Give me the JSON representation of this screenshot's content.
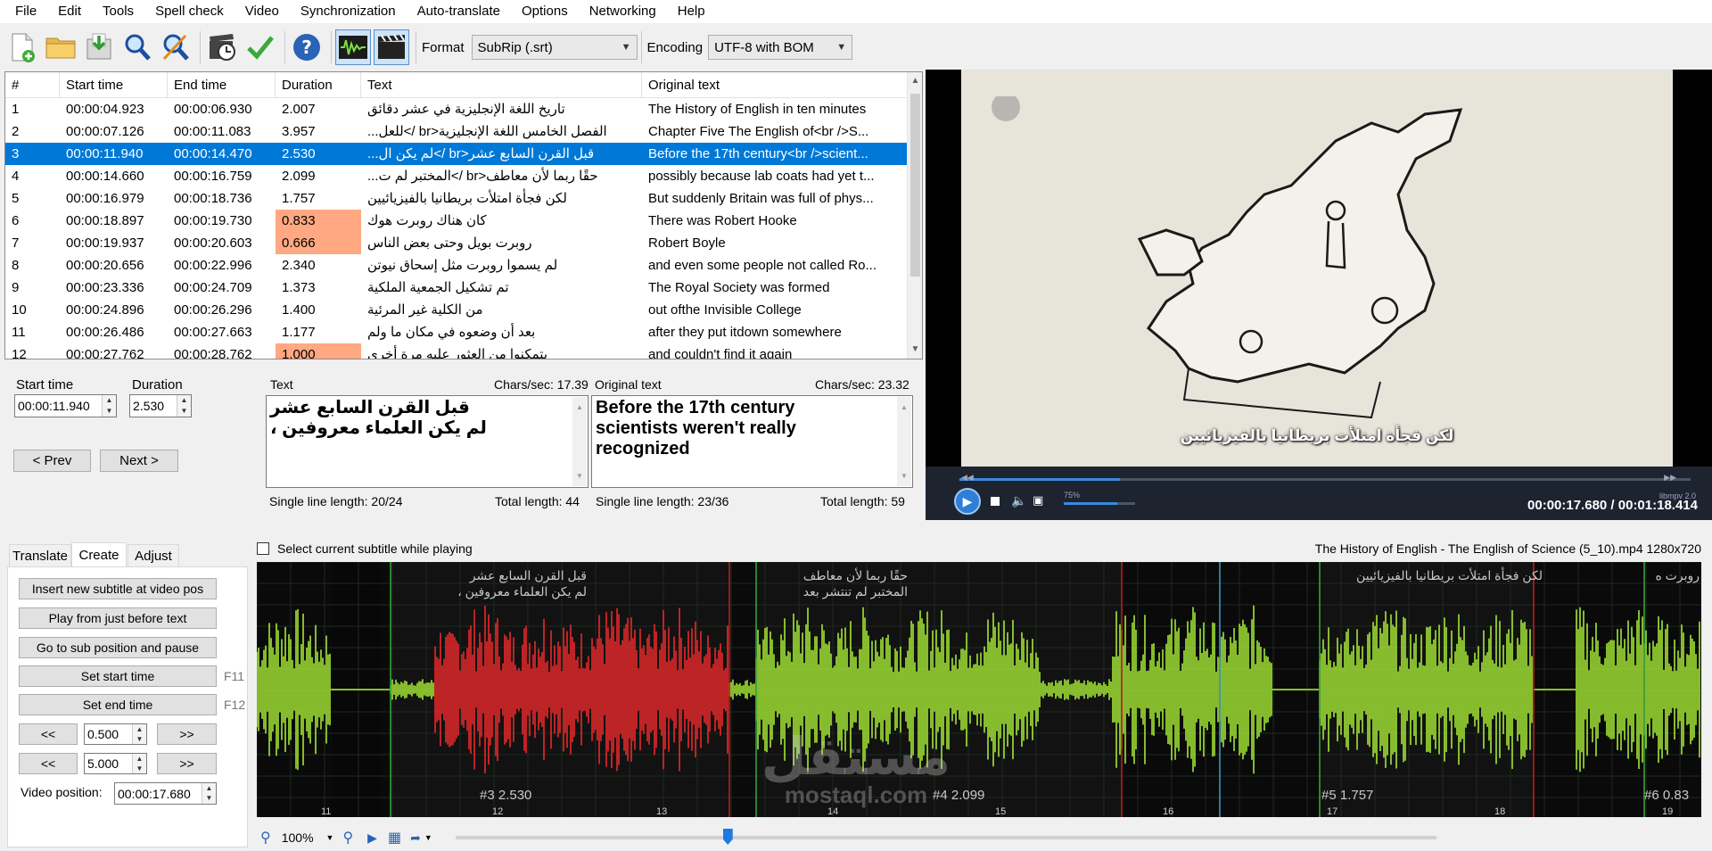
{
  "menu": [
    "File",
    "Edit",
    "Tools",
    "Spell check",
    "Video",
    "Synchronization",
    "Auto-translate",
    "Options",
    "Networking",
    "Help"
  ],
  "toolbar": {
    "icons": [
      "new-file-icon",
      "open-folder-icon",
      "save-icon",
      "find-icon",
      "replace-icon",
      "visual-sync-icon",
      "spell-check-icon",
      "help-icon",
      "waveform-toggle-icon",
      "video-toggle-icon"
    ],
    "format_label": "Format",
    "format_value": "SubRip (.srt)",
    "encoding_label": "Encoding",
    "encoding_value": "UTF-8 with BOM"
  },
  "grid": {
    "headers": [
      "#",
      "Start time",
      "End time",
      "Duration",
      "Text",
      "Original text"
    ],
    "rows": [
      {
        "num": "1",
        "start": "00:00:04.923",
        "end": "00:00:06.930",
        "dur": "2.007",
        "text": "تاريخ اللغة الإنجليزية في عشر دقائق",
        "orig": "The History of English in ten minutes"
      },
      {
        "num": "2",
        "start": "00:00:07.126",
        "end": "00:00:11.083",
        "dur": "3.957",
        "text": "الفصل الخامس اللغة الإنجليزية<br />للعل...",
        "orig": "Chapter Five The English of<br />S..."
      },
      {
        "num": "3",
        "start": "00:00:11.940",
        "end": "00:00:14.470",
        "dur": "2.530",
        "text": "قبل القرن السابع عشر<br />لم يكن ال...",
        "orig": "Before the 17th century<br />scient..."
      },
      {
        "num": "4",
        "start": "00:00:14.660",
        "end": "00:00:16.759",
        "dur": "2.099",
        "text": "حقًا ربما لأن معاطف<br />المختبر لم ت...",
        "orig": "possibly because lab coats had yet t..."
      },
      {
        "num": "5",
        "start": "00:00:16.979",
        "end": "00:00:18.736",
        "dur": "1.757",
        "text": "لكن فجأة امتلأت بريطانيا بالفيزيائيين",
        "orig": "But suddenly Britain was full of phys..."
      },
      {
        "num": "6",
        "start": "00:00:18.897",
        "end": "00:00:19.730",
        "dur": "0.833",
        "text": "كان هناك روبرت هوك",
        "orig": "There was Robert Hooke"
      },
      {
        "num": "7",
        "start": "00:00:19.937",
        "end": "00:00:20.603",
        "dur": "0.666",
        "text": "روبرت بويل وحتى بعض الناس",
        "orig": "Robert Boyle"
      },
      {
        "num": "8",
        "start": "00:00:20.656",
        "end": "00:00:22.996",
        "dur": "2.340",
        "text": "لم يسموا روبرت مثل إسحاق نيوتن",
        "orig": "and even some people not called Ro..."
      },
      {
        "num": "9",
        "start": "00:00:23.336",
        "end": "00:00:24.709",
        "dur": "1.373",
        "text": "تم تشكيل الجمعية الملكية",
        "orig": "The Royal Society was formed"
      },
      {
        "num": "10",
        "start": "00:00:24.896",
        "end": "00:00:26.296",
        "dur": "1.400",
        "text": "من الكلية غير المرئية",
        "orig": "out ofthe Invisible College"
      },
      {
        "num": "11",
        "start": "00:00:26.486",
        "end": "00:00:27.663",
        "dur": "1.177",
        "text": "بعد أن وضعوه في مكان ما ولم",
        "orig": "after they put itdown somewhere"
      },
      {
        "num": "12",
        "start": "00:00:27.762",
        "end": "00:00:28.762",
        "dur": "1.000",
        "text": "يتمكنوا من العثور عليه مرة أخرى",
        "orig": "and couldn't find it again"
      }
    ],
    "selected_row": 3,
    "warn_rows": [
      6,
      7,
      12
    ]
  },
  "edit": {
    "start_label": "Start time",
    "start_value": "00:00:11.940",
    "duration_label": "Duration",
    "duration_value": "2.530",
    "prev": "< Prev",
    "next": "Next >",
    "text_label": "Text",
    "text_cps": "Chars/sec: 17.39",
    "text_line1": "قبل القرن السابع عشر",
    "text_line2": "لم يكن العلماء معروفين ،",
    "text_single": "Single line length:  20/24",
    "text_total": "Total length: 44",
    "orig_label": "Original text",
    "orig_cps": "Chars/sec: 23.32",
    "orig_line1": "Before the 17th century",
    "orig_line2": "scientists weren't really",
    "orig_line3": "recognized",
    "orig_single": "Single line length:  23/36",
    "orig_total": "Total length: 59"
  },
  "video": {
    "subtitle": "لكن فجأة امتلأت بريطانيا بالفيزيائيين",
    "volume": "75%",
    "player": "libmpv 2.0",
    "timecode": "00:00:17.680 / 00:01:18.414",
    "progress": 0.22
  },
  "bottom": {
    "select_while_playing": "Select current subtitle while playing",
    "file_info": "The History of English - The English of Science (5_10).mp4 1280x720",
    "tabs": [
      "Translate",
      "Create",
      "Adjust"
    ],
    "buttons": [
      "Insert new subtitle at video pos",
      "Play from just before text",
      "Go to sub position and pause",
      "Set start time",
      "Set end time"
    ],
    "f11": "F11",
    "f12": "F12",
    "back": "<<",
    "fwd": ">>",
    "step1": "0.500",
    "step2": "5.000",
    "video_pos_label": "Video position:",
    "video_pos_value": "00:00:17.680",
    "zoom": "100%"
  },
  "waveform": {
    "labels": [
      {
        "l1": "قبل القرن السابع عشر",
        "l2": "لم يكن العلماء معروفين ،"
      },
      {
        "l1": "حقًا ربما لأن معاطف",
        "l2": "المختبر لم تنتشر بعد"
      },
      {
        "l1": "لكن فجأة امتلأت بريطانيا بالفيزيائيين",
        "l2": ""
      },
      {
        "l1": "روبرت ه",
        "l2": ""
      }
    ],
    "nums": [
      "#3  2.530",
      "#4  2.099",
      "#5  1.757",
      "#6  0.83"
    ],
    "ticks": [
      "11",
      "12",
      "13",
      "14",
      "15",
      "16",
      "17",
      "18",
      "19"
    ],
    "colors": {
      "active": "#e8282a",
      "normal": "#a4e636",
      "bg": "#0a0a0a"
    }
  },
  "watermark": "مستقل mostaql.com"
}
